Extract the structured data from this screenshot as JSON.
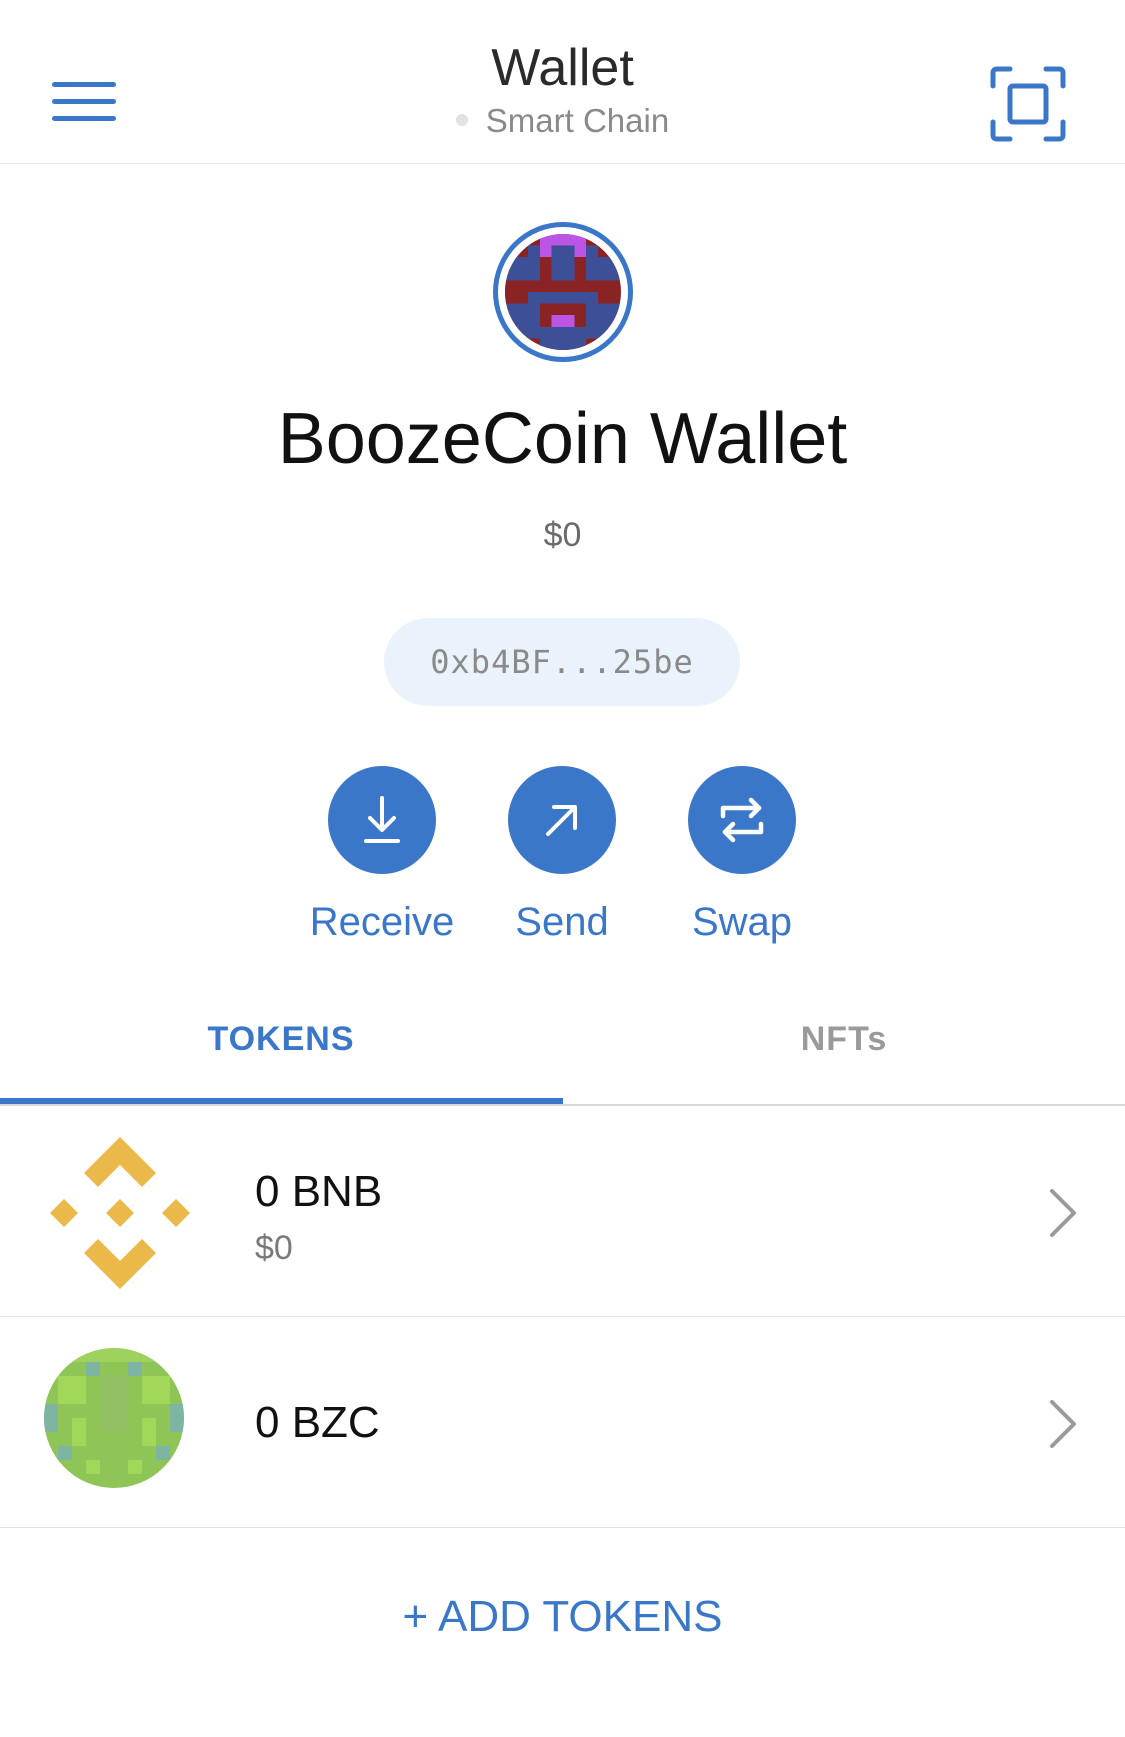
{
  "header": {
    "title": "Wallet",
    "network": "Smart Chain",
    "menu_icon": "hamburger-icon",
    "scan_icon": "qr-scan-icon"
  },
  "account": {
    "name": "BoozeCoin Wallet",
    "balance": "$0",
    "address": "0xb4BF...25be"
  },
  "actions": [
    {
      "label": "Receive",
      "icon": "download-icon"
    },
    {
      "label": "Send",
      "icon": "arrow-up-right-icon"
    },
    {
      "label": "Swap",
      "icon": "swap-icon"
    }
  ],
  "tabs": [
    {
      "label": "TOKENS",
      "active": true
    },
    {
      "label": "NFTs",
      "active": false
    }
  ],
  "tokens": [
    {
      "amount": "0 BNB",
      "value": "$0",
      "icon": "bnb-icon"
    },
    {
      "amount": "0 BZC",
      "value": "",
      "icon": "bzc-icon"
    }
  ],
  "add_tokens_label": "+ ADD TOKENS",
  "colors": {
    "accent": "#3b77c9",
    "pill_bg": "#eaf3fc",
    "bnb": "#eab949",
    "bzc": "#8fc457"
  }
}
